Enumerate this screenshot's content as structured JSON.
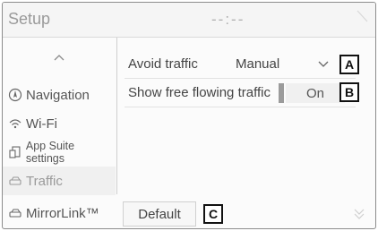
{
  "header": {
    "title": "Setup",
    "clock": "--:--"
  },
  "sidebar": {
    "items": [
      {
        "label": "Navigation",
        "icon": "navigation-icon"
      },
      {
        "label": "Wi-Fi",
        "icon": "wifi-icon"
      },
      {
        "label": "App Suite settings",
        "icon": "app-suite-icon"
      },
      {
        "label": "Traffic",
        "icon": "traffic-icon",
        "active": true
      },
      {
        "label": "MirrorLink™",
        "icon": "mirrorlink-icon"
      }
    ]
  },
  "settings": {
    "avoid_traffic": {
      "label": "Avoid traffic",
      "value": "Manual"
    },
    "free_flowing": {
      "label": "Show free flowing traffic",
      "value": "On"
    }
  },
  "default_button": {
    "label": "Default"
  },
  "callouts": {
    "a": "A",
    "b": "B",
    "c": "C"
  },
  "colors": {
    "text": "#444444",
    "muted": "#9a9a9a",
    "border": "#8c8c8c"
  }
}
